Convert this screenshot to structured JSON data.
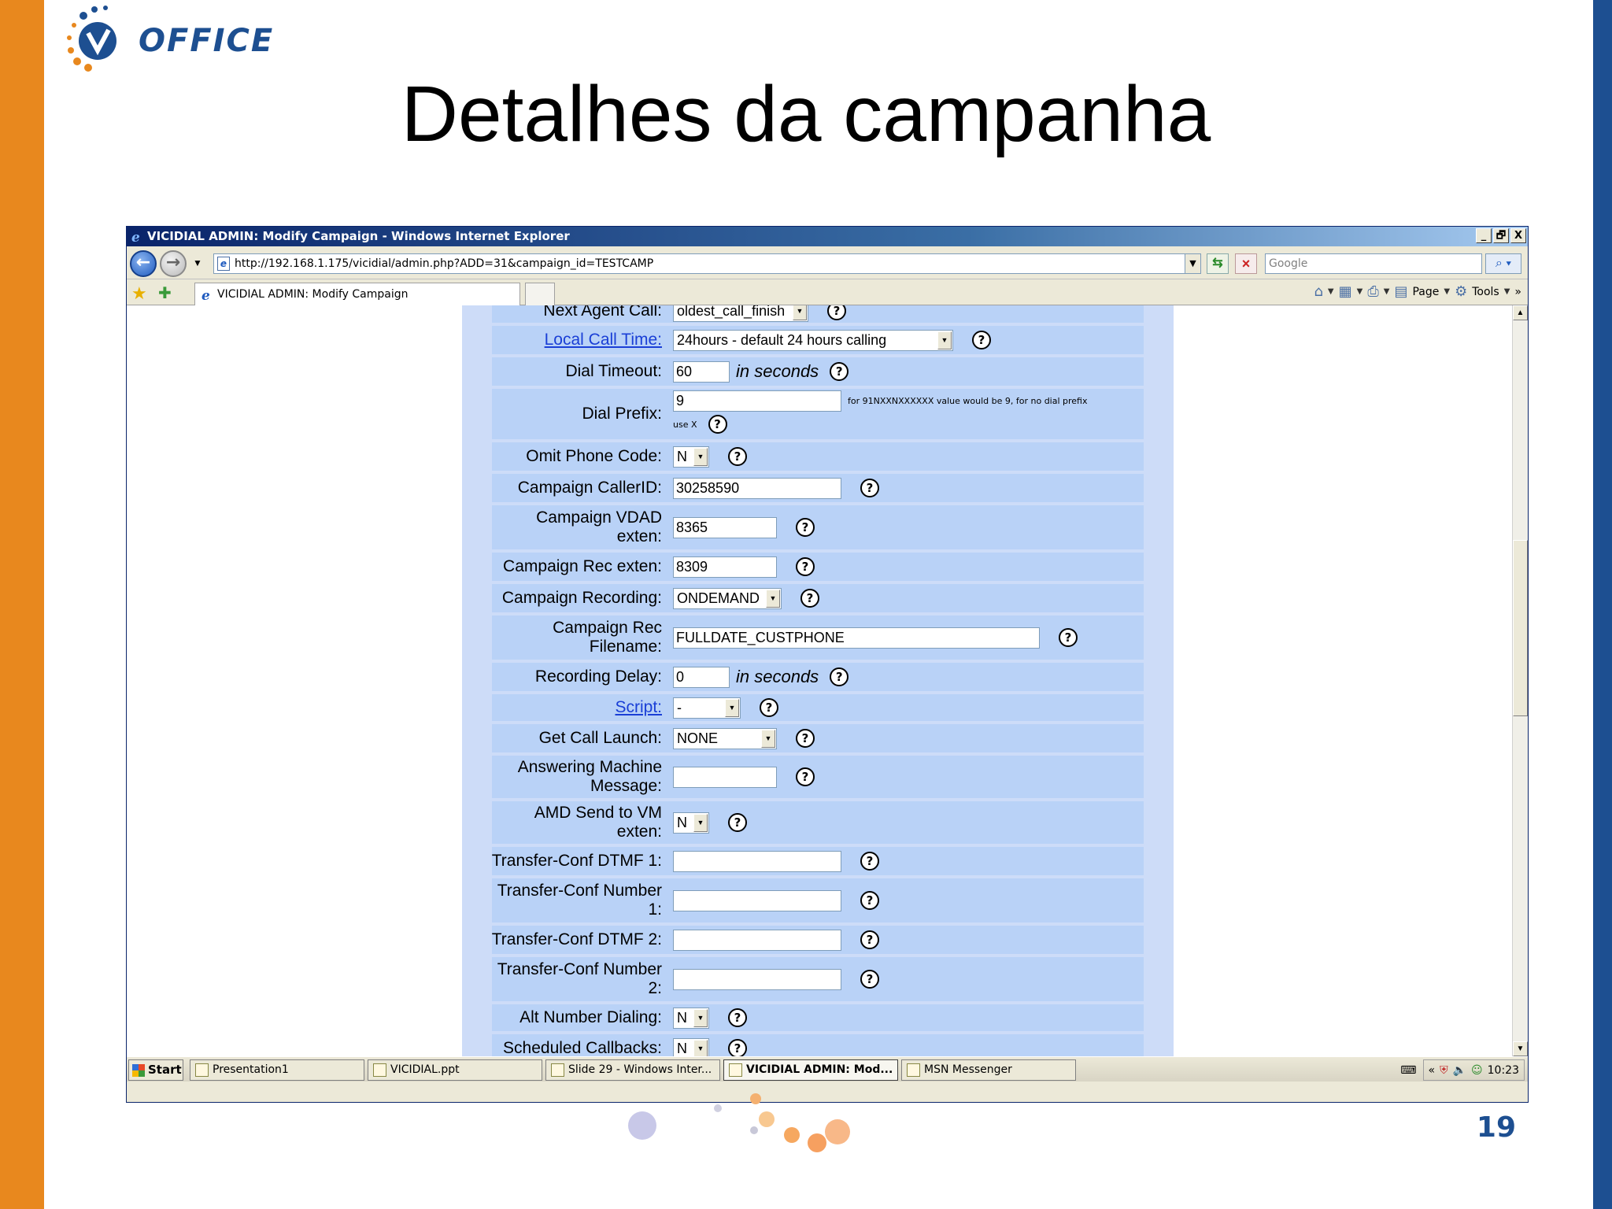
{
  "slide": {
    "logo_text": "OFFICE",
    "title": "Detalhes da campanha",
    "page_number": "19",
    "colors": {
      "left_bar": "#e8881e",
      "right_bar": "#1d4f91",
      "form_row": "#b9d2f7"
    }
  },
  "browser": {
    "window_title": "VICIDIAL ADMIN: Modify Campaign - Windows Internet Explorer",
    "window_buttons": [
      "_",
      "🗗",
      "X"
    ],
    "url": "http://192.168.1.175/vicidial/admin.php?ADD=31&campaign_id=TESTCAMP",
    "search_placeholder": "Google",
    "tab_label": "VICIDIAL ADMIN: Modify Campaign",
    "command_bar": {
      "page_label": "Page",
      "tools_label": "Tools",
      "overflow": "»"
    }
  },
  "form": {
    "rows": [
      {
        "label": "Next Agent Call:",
        "value": "oldest_call_finish",
        "kind": "select"
      },
      {
        "label": "Local Call Time:",
        "value": "24hours - default 24 hours calling",
        "kind": "select",
        "link": true
      },
      {
        "label": "Dial Timeout:",
        "value": "60",
        "unit": "in seconds",
        "kind": "input"
      },
      {
        "label": "Dial Prefix:",
        "value": "9",
        "hint": "for 91NXXNXXXXXX value would be 9, for no dial prefix",
        "hint2": "use X",
        "kind": "input"
      },
      {
        "label": "Omit Phone Code:",
        "value": "N",
        "kind": "select"
      },
      {
        "label": "Campaign CallerID:",
        "value": "30258590",
        "kind": "input"
      },
      {
        "label_line1": "Campaign VDAD",
        "label_line2": "exten:",
        "value": "8365",
        "kind": "input"
      },
      {
        "label": "Campaign Rec exten:",
        "value": "8309",
        "kind": "input"
      },
      {
        "label": "Campaign Recording:",
        "value": "ONDEMAND",
        "kind": "select"
      },
      {
        "label_line1": "Campaign Rec",
        "label_line2": "Filename:",
        "value": "FULLDATE_CUSTPHONE",
        "kind": "input"
      },
      {
        "label": "Recording Delay:",
        "value": "0",
        "unit": "in seconds",
        "kind": "input"
      },
      {
        "label": "Script:",
        "value": "-",
        "kind": "select",
        "link": true
      },
      {
        "label": "Get Call Launch:",
        "value": "NONE",
        "kind": "select"
      },
      {
        "label_line1": "Answering Machine",
        "label_line2": "Message:",
        "value": "",
        "kind": "input"
      },
      {
        "label_line1": "AMD Send to VM",
        "label_line2": "exten:",
        "value": "N",
        "kind": "select"
      },
      {
        "label": "Transfer-Conf DTMF 1:",
        "value": "",
        "kind": "input"
      },
      {
        "label_line1": "Transfer-Conf Number",
        "label_line2": "1:",
        "value": "",
        "kind": "input"
      },
      {
        "label": "Transfer-Conf DTMF 2:",
        "value": "",
        "kind": "input"
      },
      {
        "label_line1": "Transfer-Conf Number",
        "label_line2": "2:",
        "value": "",
        "kind": "input"
      },
      {
        "label": "Alt Number Dialing:",
        "value": "N",
        "kind": "select"
      },
      {
        "label": "Scheduled Callbacks:",
        "value": "N",
        "kind": "select"
      }
    ],
    "help_glyph": "?"
  },
  "taskbar": {
    "start_label": "Start",
    "tasks": [
      "Presentation1",
      "VICIDIAL.ppt",
      "Slide 29 - Windows Inter...",
      "VICIDIAL ADMIN: Mod...",
      "MSN Messenger"
    ],
    "tray_expand": "«",
    "clock": "10:23"
  }
}
